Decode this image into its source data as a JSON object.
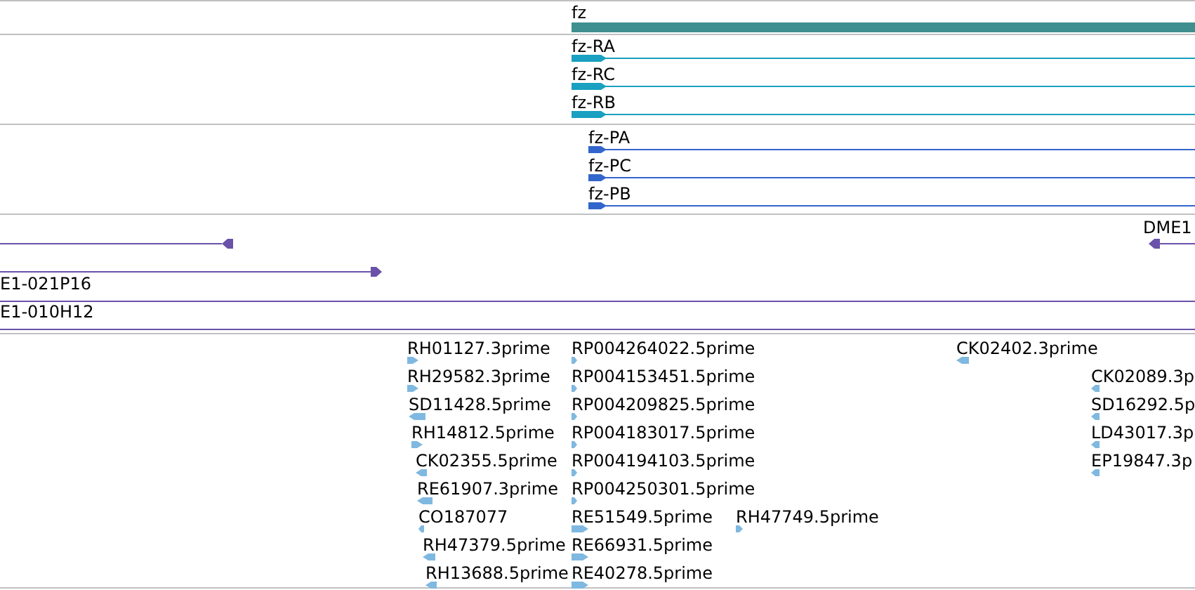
{
  "tracks": [
    {
      "kind": "gene",
      "features": [
        {
          "label": "fz"
        }
      ]
    },
    {
      "kind": "transcript",
      "features": [
        {
          "label": "fz-RA",
          "reverse": false
        },
        {
          "label": "fz-RC",
          "reverse": false
        },
        {
          "label": "fz-RB",
          "reverse": false
        }
      ]
    },
    {
      "kind": "protein",
      "features": [
        {
          "label": "fz-PA",
          "reverse": false
        },
        {
          "label": "fz-PC",
          "reverse": false
        },
        {
          "label": "fz-PB",
          "reverse": false
        }
      ]
    },
    {
      "kind": "clone",
      "features": [
        {
          "reverse": true
        },
        {
          "label": "DME1",
          "reverse": true
        },
        {
          "reverse": false
        },
        {
          "label": "E1-021P16"
        },
        {
          "label": "E1-010H12"
        }
      ]
    },
    {
      "kind": "est",
      "features": [
        {
          "label": "RH01127.3prime",
          "reverse": false
        },
        {
          "label": "RP004264022.5prime",
          "reverse": false
        },
        {
          "label": "CK02402.3prime",
          "reverse": true
        },
        {
          "label": "RH29582.3prime",
          "reverse": false
        },
        {
          "label": "RP004153451.5prime",
          "reverse": false
        },
        {
          "label": "CK02089.3p",
          "reverse": true
        },
        {
          "label": "SD11428.5prime",
          "reverse": true
        },
        {
          "label": "RP004209825.5prime",
          "reverse": false
        },
        {
          "label": "SD16292.5p",
          "reverse": true
        },
        {
          "label": "RH14812.5prime",
          "reverse": false
        },
        {
          "label": "RP004183017.5prime",
          "reverse": false
        },
        {
          "label": "LD43017.3p",
          "reverse": true
        },
        {
          "label": "CK02355.5prime",
          "reverse": true
        },
        {
          "label": "RP004194103.5prime",
          "reverse": false
        },
        {
          "label": "EP19847.3p",
          "reverse": true
        },
        {
          "label": "RE61907.3prime",
          "reverse": true
        },
        {
          "label": "RP004250301.5prime",
          "reverse": false
        },
        {
          "label": "CO187077",
          "reverse": true
        },
        {
          "label": "RE51549.5prime",
          "reverse": false
        },
        {
          "label": "RH47749.5prime",
          "reverse": false
        },
        {
          "label": "RH47379.5prime",
          "reverse": true
        },
        {
          "label": "RE66931.5prime",
          "reverse": false
        },
        {
          "label": "RH13688.5prime",
          "reverse": true
        },
        {
          "label": "RE40278.5prime",
          "reverse": false
        }
      ]
    }
  ]
}
